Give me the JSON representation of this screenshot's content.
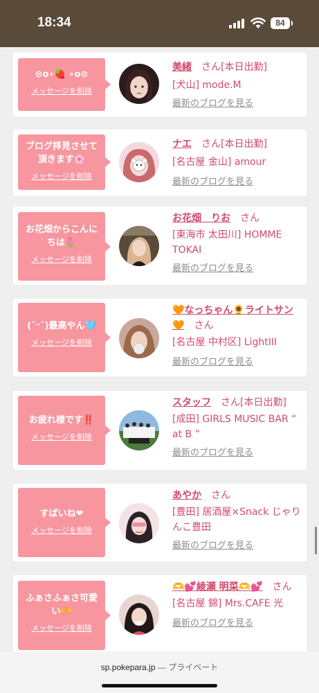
{
  "status": {
    "time": "18:34",
    "battery": "84"
  },
  "browser": {
    "domain": "sp.pokepara.jp",
    "separator": "—",
    "mode": "プライベート"
  },
  "common": {
    "delete_label": "メッセージを削除",
    "blog_label": "最新のブログを見る",
    "san": "さん"
  },
  "cards": [
    {
      "message": "⊙o∘🍓 ∘o⊙",
      "name": "美緒",
      "status": "[本日出勤]",
      "shop": "[犬山] mode.M"
    },
    {
      "message": "ブログ拝見させて頂きます🌸",
      "name": "ナエ",
      "status": "[本日出勤]",
      "shop": "[名古屋 金山] amour"
    },
    {
      "message": "お花畑からこんにちは🌷",
      "name": "お花畑　りお",
      "status": "",
      "shop": "[東海市 太田川] HOMME TOKAI"
    },
    {
      "message": "(˘ᵕ˘)最高やん🩵",
      "name": "🧡なっちゃん🌻ライトサン🧡",
      "status": "",
      "shop": "[名古屋 中村区] LightIII"
    },
    {
      "message": "お疲れ様です‼️",
      "name": "スタッフ",
      "status": "[本日出勤]",
      "shop": "[成田] GIRLS MUSIC BAR “ at B ”"
    },
    {
      "message": "すばいね❤",
      "name": "あやか",
      "status": "",
      "shop": "[豊田] 居酒屋×Snack じゃりんこ豊田"
    },
    {
      "message": "ふぁさふぁさ可愛い🫶",
      "name": "🫶💕綾瀬 明菜🫶💕",
      "status": "",
      "shop": "[名古屋 錦] Mrs.CAFE 光"
    }
  ],
  "colors": {
    "accent": "#d14a6e",
    "bubble": "#f7969f",
    "status_bar": "#5a4a3a"
  }
}
